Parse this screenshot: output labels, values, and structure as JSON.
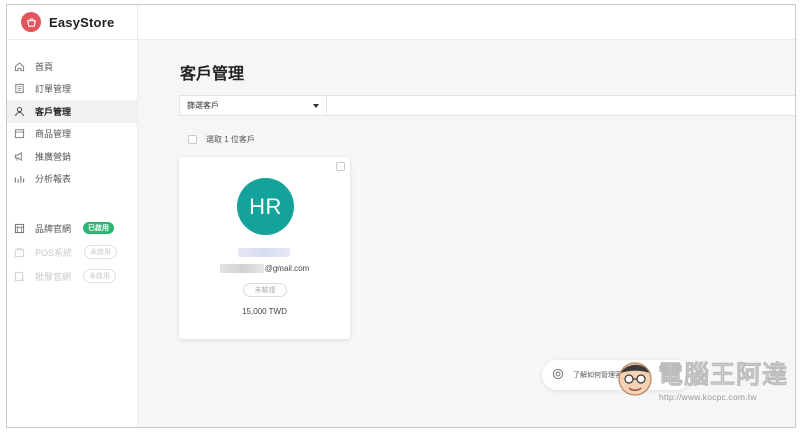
{
  "brand": {
    "name": "EasyStore"
  },
  "sidebar": {
    "items": [
      {
        "label": "首頁",
        "icon": "home-icon"
      },
      {
        "label": "訂單管理",
        "icon": "orders-icon"
      },
      {
        "label": "客戶管理",
        "icon": "customer-icon",
        "active": true
      },
      {
        "label": "商品管理",
        "icon": "products-icon"
      },
      {
        "label": "推廣營銷",
        "icon": "megaphone-icon"
      },
      {
        "label": "分析報表",
        "icon": "analytics-icon"
      }
    ],
    "channels": [
      {
        "label": "品牌官網",
        "badge": "已啟用",
        "icon": "store-icon",
        "enabled": true
      },
      {
        "label": "POS系統",
        "badge": "未啟用",
        "icon": "pos-icon",
        "enabled": false
      },
      {
        "label": "批發官網",
        "badge": "未啟用",
        "icon": "wholesale-icon",
        "enabled": false
      }
    ]
  },
  "main": {
    "title": "客戶管理",
    "filter": {
      "label": "篩選客戶"
    },
    "select_all": "選取 1 位客戶",
    "customer_card": {
      "initials": "HR",
      "email_suffix": "@gmail.com",
      "status": "未驗證",
      "amount": "15,000 TWD",
      "avatar_color": "#14a39a"
    },
    "help": {
      "text": "了解如何管理客戶資料"
    }
  },
  "watermark": {
    "text": "電腦王阿達",
    "url": "http://www.kocpc.com.tw"
  },
  "colors": {
    "brand": "#e2555a",
    "accent": "#14a39a",
    "badge_green": "#2bb673"
  }
}
